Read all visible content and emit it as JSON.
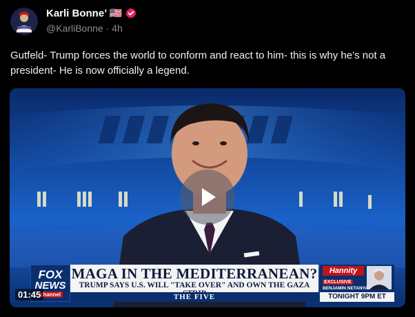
{
  "post": {
    "author": {
      "display_name": "Karli Bonne’ 🇺🇸",
      "handle": "@KarliBonne",
      "separator": " · ",
      "age": "4h",
      "verified": true
    },
    "text": "Gutfeld- Trump forces the world to conform and react to him- this is why he’s not a president- He is now officially a legend.",
    "media": {
      "type": "video",
      "duration": "01:45",
      "lower_third": {
        "network_line1": "FOX",
        "network_line2": "NEWS",
        "network_line3": "channel",
        "headline": "MAGA IN THE MEDITERRANEAN?",
        "subheadline": "TRUMP SAYS U.S. WILL \"TAKE OVER\" AND OWN THE GAZA STRIP",
        "show": "THE FIVE",
        "promo": {
          "show_name": "Hannity",
          "tag": "EXCLUSIVE",
          "guest": "BENJAMIN NETANYAHU",
          "time_slot": "TONIGHT 9PM ET"
        }
      }
    }
  },
  "icons": {
    "verified": "verified-badge-icon",
    "play": "play-icon"
  },
  "colors": {
    "background": "#000000",
    "verified": "#e0245e",
    "fox_red": "#c0141b",
    "fox_blue": "#0b2f6e"
  }
}
